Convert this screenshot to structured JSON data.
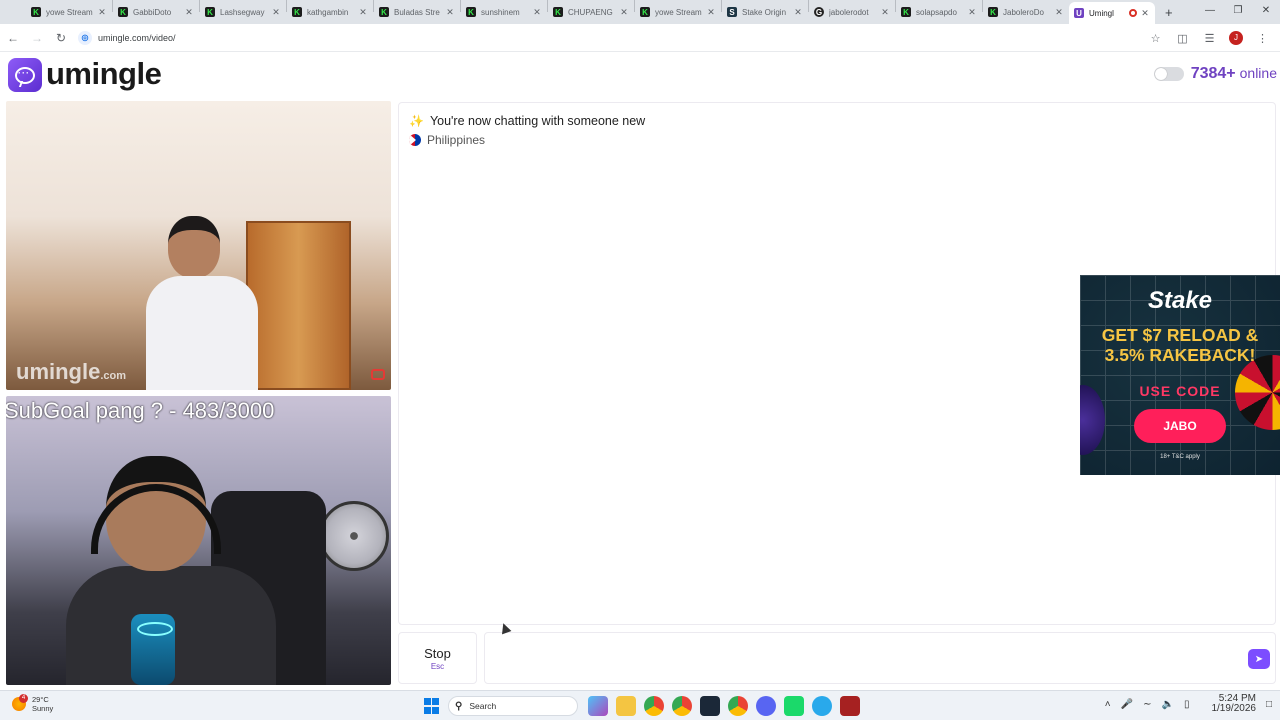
{
  "browser": {
    "tabs": [
      {
        "label": "yowe Stream",
        "favicon": "K",
        "active": false
      },
      {
        "label": "GabbiDoto",
        "favicon": "K",
        "active": false
      },
      {
        "label": "Lashsegway",
        "favicon": "K",
        "active": false
      },
      {
        "label": "kathgambin",
        "favicon": "K",
        "active": false
      },
      {
        "label": "Buladas Stre",
        "favicon": "K",
        "active": false
      },
      {
        "label": "sunshinem",
        "favicon": "K",
        "active": false
      },
      {
        "label": "CHUPAENG",
        "favicon": "K",
        "active": false
      },
      {
        "label": "yowe Stream",
        "favicon": "K",
        "active": false
      },
      {
        "label": "Stake Origin",
        "favicon": "S",
        "active": false
      },
      {
        "label": "jabolerodot",
        "favicon": "G",
        "active": false
      },
      {
        "label": "solapsapdo",
        "favicon": "K",
        "active": false
      },
      {
        "label": "JaboleroDo",
        "favicon": "K",
        "active": false
      },
      {
        "label": "Umingl",
        "favicon": "U",
        "active": true
      }
    ],
    "new_tab": "+",
    "url": "umingle.com/video/",
    "profile_initial": "J"
  },
  "site": {
    "logo_text": "umingle",
    "online_count": "7384+",
    "online_label": "online"
  },
  "video_top": {
    "watermark": "umingle",
    "watermark_suffix": ".com"
  },
  "video_bottom": {
    "overlay_text": "SubGoal pang ? - 483/3000"
  },
  "chat": {
    "status": "You're now chatting with someone new",
    "country": "Philippines"
  },
  "ad": {
    "brand": "Stake",
    "headline": "GET $7 RELOAD & 3.5% RAKEBACK!",
    "use_code_label": "USE CODE",
    "code": "JABO",
    "fine_print": "18+ T&C apply"
  },
  "controls": {
    "stop_label": "Stop",
    "stop_shortcut": "Esc",
    "message_placeholder": ""
  },
  "taskbar": {
    "weather_temp": "29°C",
    "weather_desc": "Sunny",
    "weather_badge": "4",
    "search_label": "Search",
    "time": "5:24 PM",
    "date": "1/19/2026"
  },
  "colors": {
    "brand_purple": "#6f42c1",
    "ad_pink": "#ff1f5a",
    "ad_gold": "#f6c543"
  }
}
